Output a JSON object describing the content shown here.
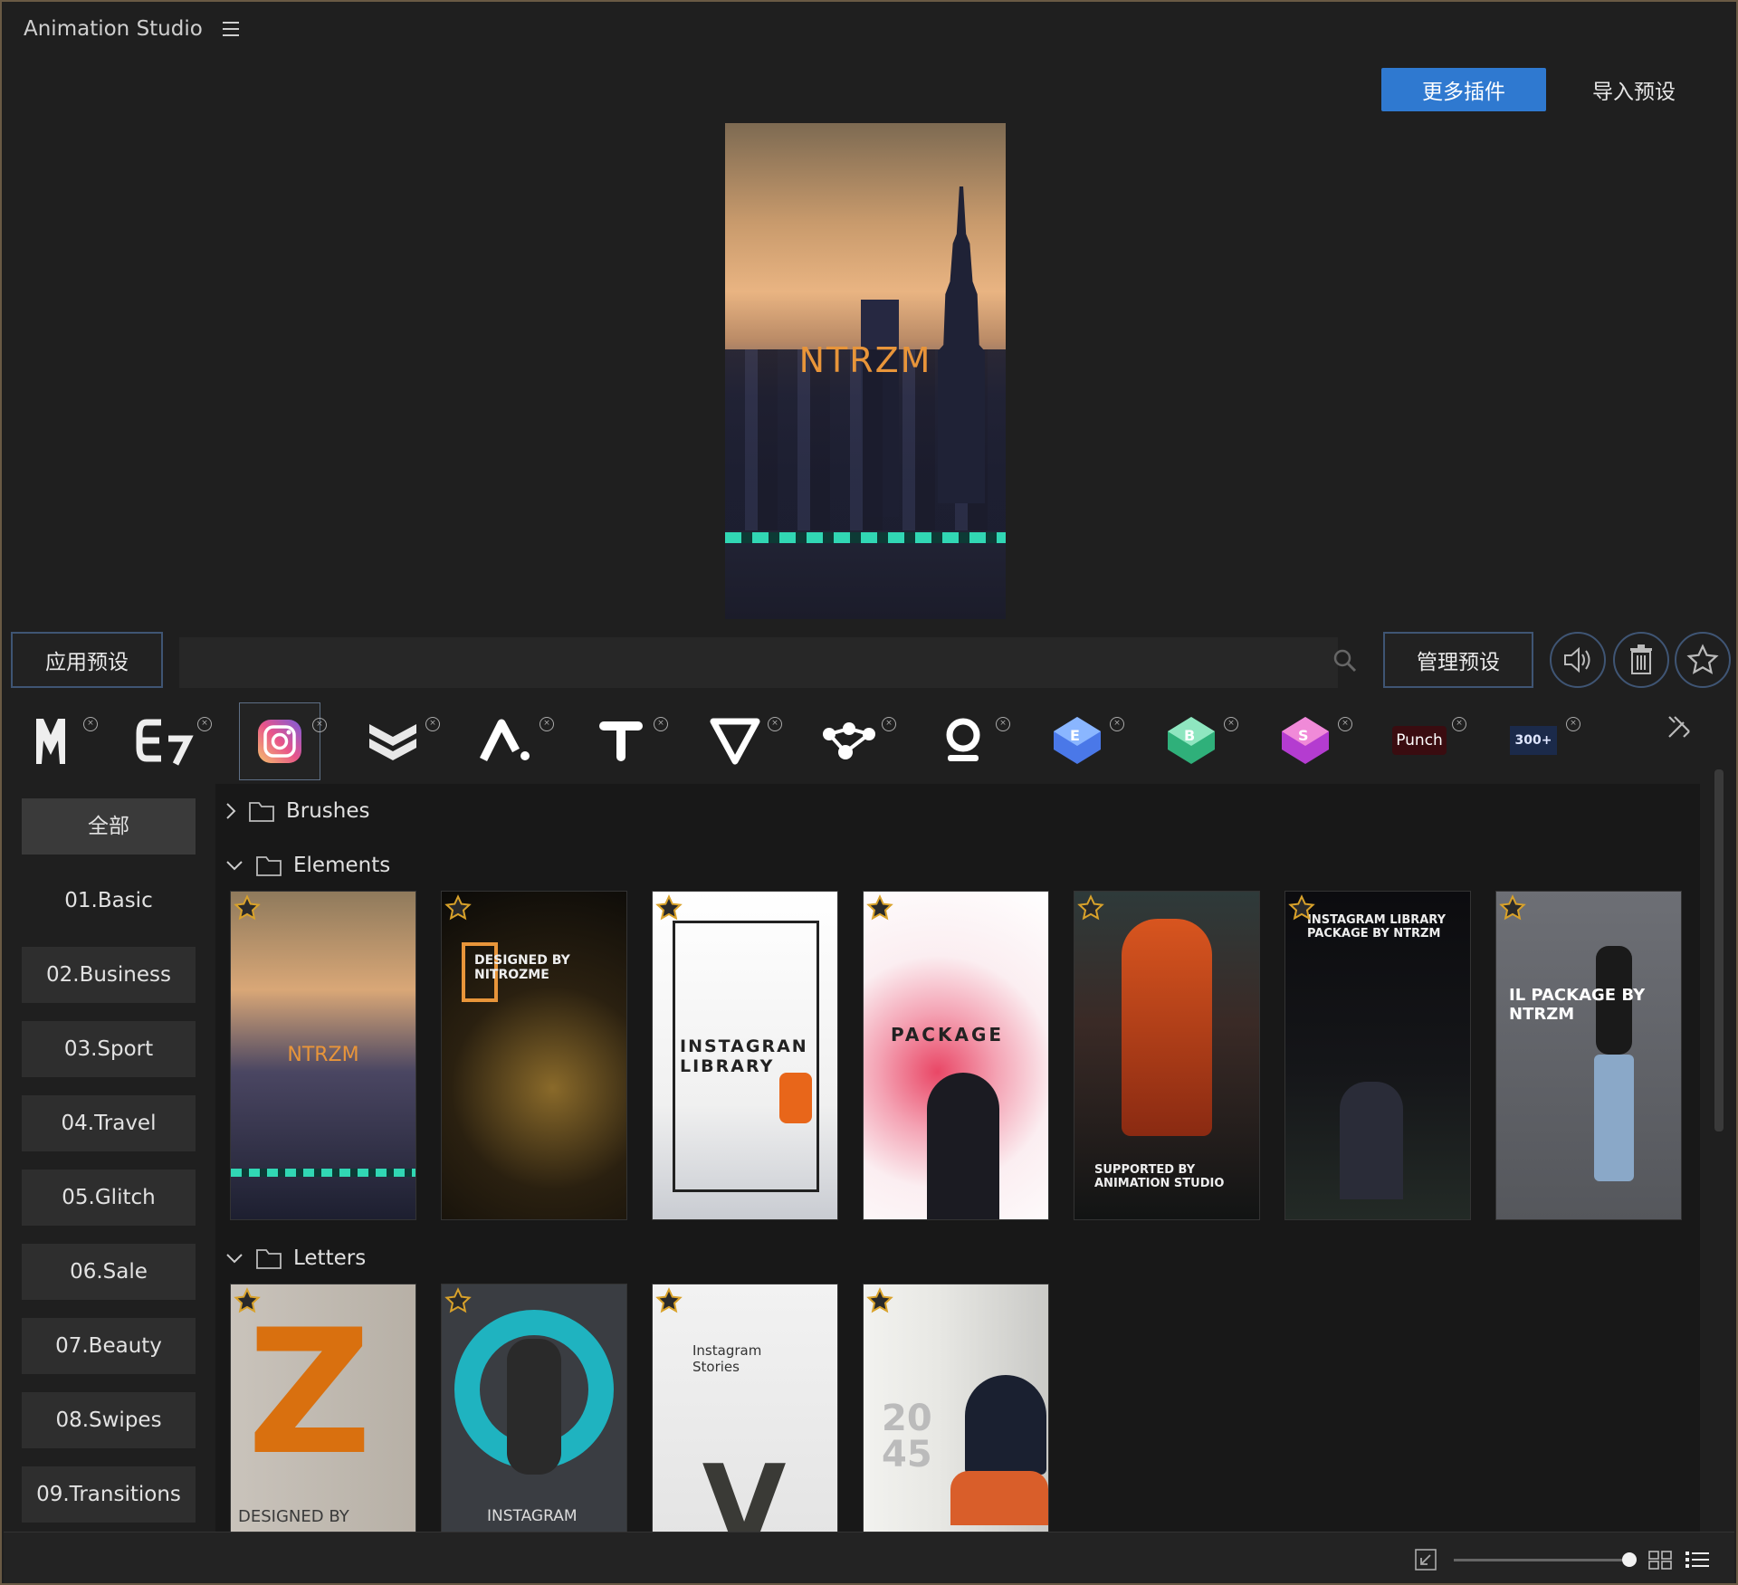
{
  "app": {
    "title": "Animation Studio"
  },
  "header": {
    "more_plugins": "更多插件",
    "import_presets": "导入预设"
  },
  "preview": {
    "overlay_text": "NTRZM"
  },
  "toolbar": {
    "apply_preset": "应用预设",
    "search_value": "",
    "search_placeholder": "",
    "manage_presets": "管理预设"
  },
  "plugins": [
    {
      "icon": "m-logo-icon",
      "label": "M"
    },
    {
      "icon": "e7-logo-icon",
      "label": "E7"
    },
    {
      "icon": "instagram-icon",
      "label": "Instagram",
      "selected": true
    },
    {
      "icon": "chevron-stack-icon",
      "label": ""
    },
    {
      "icon": "a-logo-icon",
      "label": "A"
    },
    {
      "icon": "t-logo-icon",
      "label": "T"
    },
    {
      "icon": "v-logo-icon",
      "label": "V"
    },
    {
      "icon": "molecule-icon",
      "label": ""
    },
    {
      "icon": "o-logo-icon",
      "label": "O"
    },
    {
      "icon": "e-3d-icon",
      "label": "E"
    },
    {
      "icon": "b-3d-icon",
      "label": "B"
    },
    {
      "icon": "s-3d-icon",
      "label": "S"
    },
    {
      "icon": "punch-logo-icon",
      "label": "Punch"
    },
    {
      "icon": "300-logo-icon",
      "label": "300+"
    }
  ],
  "sidebar": {
    "categories": [
      "全部",
      "01.Basic",
      "02.Business",
      "03.Sport",
      "04.Travel",
      "05.Glitch",
      "06.Sale",
      "07.Beauty",
      "08.Swipes",
      "09.Transitions"
    ]
  },
  "folders": {
    "brushes": "Brushes",
    "elements": "Elements",
    "letters": "Letters"
  },
  "elements_thumbs": [
    {
      "text": "NTRZM"
    },
    {
      "text": "DESIGNED BY NITROZME"
    },
    {
      "text": "INSTAGRAN LIBRARY"
    },
    {
      "text": "PACKAGE"
    },
    {
      "text": "SUPPORTED BY ANIMATION STUDIO"
    },
    {
      "text": "INSTAGRAM LIBRARY PACKAGE BY NTRZM"
    },
    {
      "text": "IL PACKAGE BY NTRZM"
    }
  ],
  "letters_thumbs": [
    {
      "text": "DESIGNED BY"
    },
    {
      "text": "INSTAGRAM"
    },
    {
      "text": "Instagram Stories"
    },
    {
      "text": "20 45"
    }
  ],
  "colors": {
    "accent": "#2f79d0",
    "teal": "#31d7b4",
    "orange": "#e8953a"
  }
}
